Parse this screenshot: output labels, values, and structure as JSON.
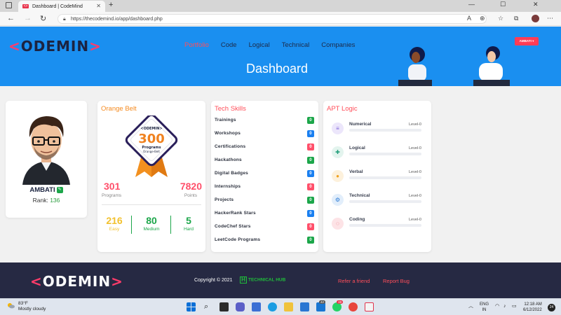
{
  "browser": {
    "tab_title": "Dashboard | CodeMind",
    "new_tab": "+",
    "url": "https://thecodemind.io/app/dashboard.php",
    "nav_icons": [
      "back-arrow-icon",
      "forward-arrow-icon",
      "refresh-icon"
    ],
    "window_controls": [
      "minimize",
      "maximize",
      "close"
    ]
  },
  "site": {
    "logo_left": "<",
    "logo_text": "ODEMIN",
    "logo_right": ">",
    "menu": [
      {
        "label": "Portfolio",
        "active": true
      },
      {
        "label": "Code",
        "active": false
      },
      {
        "label": "Logical",
        "active": false
      },
      {
        "label": "Technical",
        "active": false
      },
      {
        "label": "Companies",
        "active": false
      }
    ],
    "page_title": "Dashboard",
    "user_button": "AMBATI ▾"
  },
  "profile": {
    "name": "AMBATI",
    "rank_label": "Rank:",
    "rank_value": "136"
  },
  "belt": {
    "title": "Orange Belt",
    "badge_logo": "<ODEMIN>",
    "badge_number": "300",
    "badge_line1": "Programs",
    "badge_line2": "Orange-Belt",
    "programs_value": "301",
    "programs_label": "Programs",
    "points_value": "7820",
    "points_label": "Points",
    "easy_value": "216",
    "easy_label": "Easy",
    "medium_value": "80",
    "medium_label": "Medium",
    "hard_value": "5",
    "hard_label": "Hard"
  },
  "skills": {
    "title": "Tech Skills",
    "items": [
      {
        "label": "Trainings",
        "count": "0",
        "color": "#1ca64a"
      },
      {
        "label": "Workshops",
        "count": "0",
        "color": "#1a7ff0"
      },
      {
        "label": "Certifications",
        "count": "0",
        "color": "#ff4f6a"
      },
      {
        "label": "Hackathons",
        "count": "0",
        "color": "#1ca64a"
      },
      {
        "label": "Digital Badges",
        "count": "0",
        "color": "#1a7ff0"
      },
      {
        "label": "Internships",
        "count": "0",
        "color": "#ff4f6a"
      },
      {
        "label": "Projects",
        "count": "0",
        "color": "#1ca64a"
      },
      {
        "label": "HackerRank Stars",
        "count": "0",
        "color": "#1a7ff0"
      },
      {
        "label": "CodeChef Stars",
        "count": "0",
        "color": "#ff4f6a"
      },
      {
        "label": "LeetCode Programs",
        "count": "0",
        "color": "#1ca64a"
      }
    ]
  },
  "apt": {
    "title": "APT Logic",
    "items": [
      {
        "label": "Numerical",
        "level": "Level-0",
        "icon": "list-icon",
        "bg": "#ece6fb",
        "fg": "#7b61d8",
        "glyph": "≡"
      },
      {
        "label": "Logical",
        "level": "Level-0",
        "icon": "puzzle-icon",
        "bg": "#e3f4ee",
        "fg": "#1f9c78",
        "glyph": "✚"
      },
      {
        "label": "Verbal",
        "level": "Level-0",
        "icon": "chat-icon",
        "bg": "#fdf1dc",
        "fg": "#f0a21f",
        "glyph": "●"
      },
      {
        "label": "Technical",
        "level": "Level-0",
        "icon": "gears-icon",
        "bg": "#e2eefb",
        "fg": "#2b7ad6",
        "glyph": "⚙"
      },
      {
        "label": "Coding",
        "level": "Level-0",
        "icon": "code-icon",
        "bg": "#fde3e6",
        "fg": "#e14758",
        "glyph": "◌"
      }
    ]
  },
  "footer": {
    "copyright": "Copyright © 2021",
    "partner_mark": "H",
    "partner": "TECHNICAL HUB",
    "link_refer": "Refer a friend",
    "link_report": "Report Bug"
  },
  "taskbar": {
    "temperature": "83°F",
    "weather": "Mostly cloudy",
    "lang_line1": "ENG",
    "lang_line2": "IN",
    "time": "12:18 AM",
    "date": "6/12/2022",
    "notifications": "24",
    "badge_a": "42",
    "badge_b": "19"
  },
  "colors": {
    "hero_blue": "#1a8ff0",
    "accent_red": "#ff4e5a",
    "footer_bg": "#262943",
    "easy": "#f2c12e",
    "medium_hard": "#1ca64a"
  }
}
